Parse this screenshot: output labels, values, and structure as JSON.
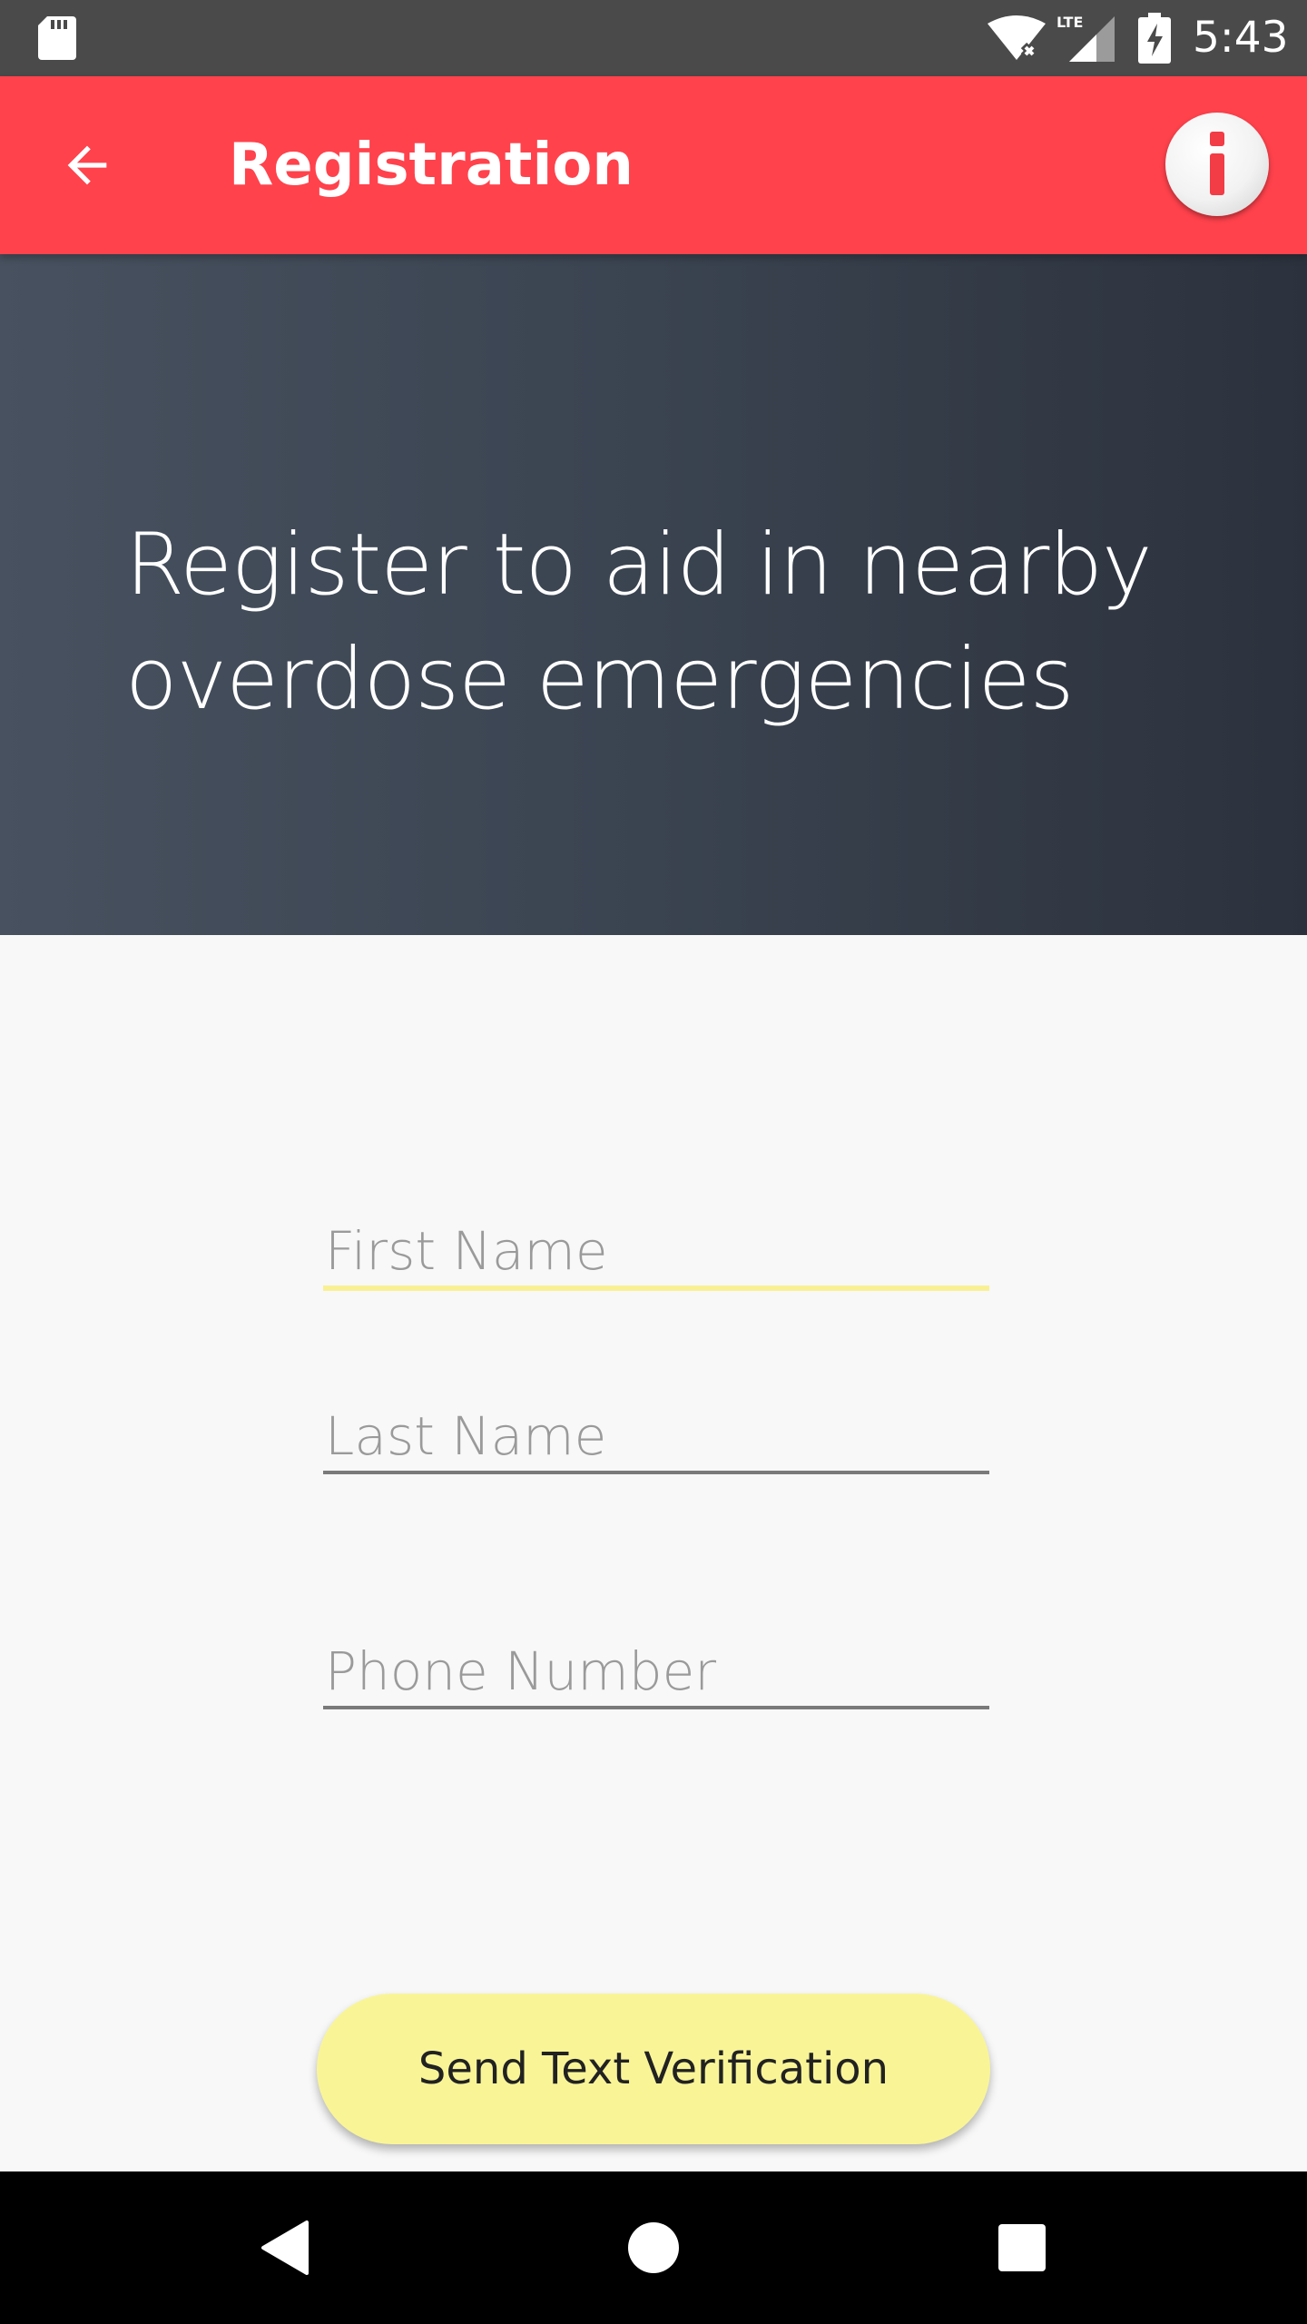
{
  "status_bar": {
    "time": "5:43",
    "network_label": "LTE",
    "icons": [
      "sd-card-icon",
      "wifi-icon",
      "signal-icon",
      "battery-charging-icon"
    ]
  },
  "app_bar": {
    "title": "Registration",
    "back_icon": "arrow-back-icon",
    "info_icon": "info-icon"
  },
  "hero": {
    "headline_line1": "Register to aid in nearby",
    "headline_line2": "overdose emergencies"
  },
  "form": {
    "first_name": {
      "placeholder": "First Name",
      "value": ""
    },
    "last_name": {
      "placeholder": "Last Name",
      "value": ""
    },
    "phone": {
      "placeholder": "Phone Number",
      "value": ""
    },
    "submit_label": "Send Text Verification"
  },
  "nav_bar": {
    "icons": [
      "nav-back-icon",
      "nav-home-icon",
      "nav-recents-icon"
    ]
  },
  "colors": {
    "app_bar": "#ff424c",
    "hero_start": "#47515f",
    "hero_end": "#2c323d",
    "accent_yellow": "#f9f597",
    "status_bar": "#4a4a4a"
  }
}
